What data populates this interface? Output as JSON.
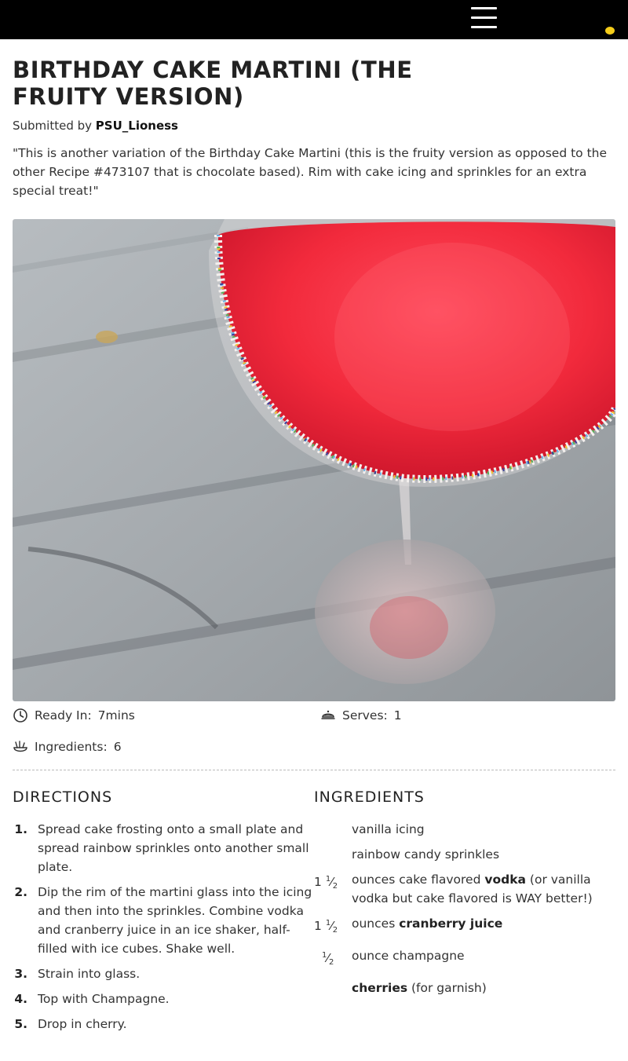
{
  "header": {
    "menu_icon": "hamburger-menu-icon",
    "notification_color": "#f5cd1a"
  },
  "recipe": {
    "title": "BIRTHDAY CAKE MARTINI (THE FRUITY VERSION)",
    "submitted_label": "Submitted by",
    "author": "PSU_Lioness",
    "description": "\"This is another variation of the Birthday Cake Martini (this is the fruity version as opposed to the other Recipe #473107 that is chocolate based). Rim with cake icing and sprinkles for an extra special treat!\""
  },
  "facts": {
    "ready_label": "Ready In:",
    "ready_value": "7mins",
    "serves_label": "Serves:",
    "serves_value": "1",
    "ingredients_label": "Ingredients:",
    "ingredients_value": "6"
  },
  "directions": {
    "heading": "DIRECTIONS",
    "steps": [
      {
        "num": "1.",
        "text": "Spread cake frosting onto a small plate and spread rainbow sprinkles onto another small plate."
      },
      {
        "num": "2.",
        "text": "Dip the rim of the martini glass into the icing and then into the sprinkles. Combine vodka and cranberry juice in an ice shaker, half-filled with ice cubes. Shake well."
      },
      {
        "num": "3.",
        "text": "Strain into glass."
      },
      {
        "num": "4.",
        "text": "Top with Champagne."
      },
      {
        "num": "5.",
        "text": "Drop in cherry."
      }
    ]
  },
  "ingredients": {
    "heading": "INGREDIENTS",
    "items": [
      {
        "qty_whole": "",
        "qty_num": "",
        "qty_den": "",
        "name_pre": "vanilla icing",
        "name_bold": "",
        "name_post": ""
      },
      {
        "qty_whole": "",
        "qty_num": "",
        "qty_den": "",
        "name_pre": "rainbow candy sprinkles",
        "name_bold": "",
        "name_post": ""
      },
      {
        "qty_whole": "1",
        "qty_num": "1",
        "qty_den": "2",
        "name_pre": "ounces cake flavored ",
        "name_bold": "vodka",
        "name_post": " (or vanilla vodka but cake flavored is WAY better!)"
      },
      {
        "qty_whole": "1",
        "qty_num": "1",
        "qty_den": "2",
        "name_pre": "ounces ",
        "name_bold": "cranberry juice",
        "name_post": ""
      },
      {
        "qty_whole": "",
        "qty_num": "1",
        "qty_den": "2",
        "name_pre": "ounce champagne",
        "name_bold": "",
        "name_post": ""
      },
      {
        "qty_whole": "",
        "qty_num": "",
        "qty_den": "",
        "name_pre": "",
        "name_bold": "cherries",
        "name_post": " (for garnish)"
      }
    ]
  }
}
